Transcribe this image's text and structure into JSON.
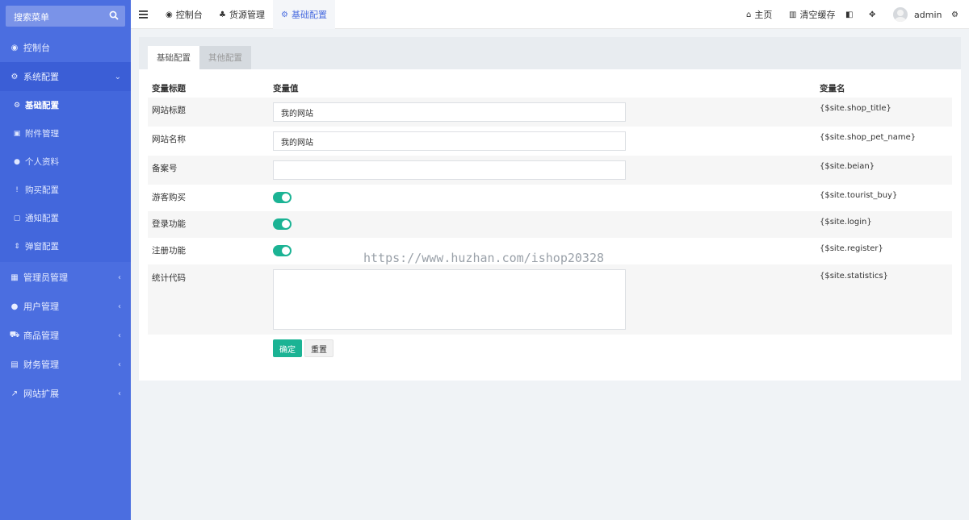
{
  "sidebar": {
    "search_placeholder": "搜索菜单",
    "items": [
      {
        "label": "控制台"
      },
      {
        "label": "系统配置"
      },
      {
        "label": "管理员管理"
      },
      {
        "label": "用户管理"
      },
      {
        "label": "商品管理"
      },
      {
        "label": "财务管理"
      },
      {
        "label": "网站扩展"
      }
    ],
    "submenu": [
      {
        "label": "基础配置"
      },
      {
        "label": "附件管理"
      },
      {
        "label": "个人资料"
      },
      {
        "label": "购买配置"
      },
      {
        "label": "通知配置"
      },
      {
        "label": "弹窗配置"
      }
    ]
  },
  "topbar": {
    "tabs": [
      {
        "label": "控制台"
      },
      {
        "label": "货源管理"
      },
      {
        "label": "基础配置"
      }
    ],
    "home": "主页",
    "clear_cache": "清空缓存",
    "username": "admin"
  },
  "panel": {
    "tabs": [
      "基础配置",
      "其他配置"
    ],
    "headers": {
      "title": "变量标题",
      "value": "变量值",
      "name": "变量名"
    },
    "rows": [
      {
        "label": "网站标题",
        "value": "我的网站",
        "var": "{$site.shop_title}"
      },
      {
        "label": "网站名称",
        "value": "我的网站",
        "var": "{$site.shop_pet_name}"
      },
      {
        "label": "备案号",
        "value": "",
        "var": "{$site.beian}"
      },
      {
        "label": "游客购买",
        "var": "{$site.tourist_buy}",
        "on": true
      },
      {
        "label": "登录功能",
        "var": "{$site.login}",
        "on": true
      },
      {
        "label": "注册功能",
        "var": "{$site.register}",
        "on": true
      },
      {
        "label": "统计代码",
        "value": "",
        "var": "{$site.statistics}"
      }
    ],
    "buttons": {
      "ok": "确定",
      "reset": "重置"
    }
  },
  "watermark": "https://www.huzhan.com/ishop20328",
  "colors": {
    "sidebar": "#4b6ee0",
    "accent": "#1bb394",
    "active_tab_text": "#4b6ee0"
  }
}
